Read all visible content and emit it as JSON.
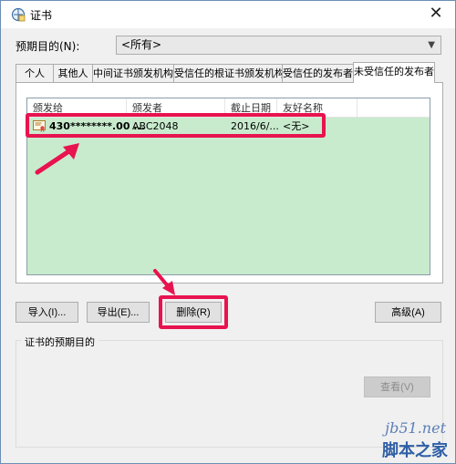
{
  "window": {
    "title": "证书",
    "close_glyph": "✕"
  },
  "purpose": {
    "label": "预期目的(N):",
    "selected": "<所有>"
  },
  "tabs": [
    {
      "label": "个人",
      "active": false
    },
    {
      "label": "其他人",
      "active": false
    },
    {
      "label": "中间证书颁发机构",
      "active": false
    },
    {
      "label": "受信任的根证书颁发机构",
      "active": false
    },
    {
      "label": "受信任的发布者",
      "active": false
    },
    {
      "label": "未受信任的发布者",
      "active": true
    }
  ],
  "list": {
    "columns": [
      "颁发给",
      "颁发者",
      "截止日期",
      "友好名称"
    ],
    "rows": [
      {
        "issued_to": "430********.00 ...",
        "issuer": "ABC2048",
        "expiry": "2016/6/...",
        "friendly": "<无>"
      }
    ],
    "background": "#c8ebcd"
  },
  "buttons": {
    "import": "导入(I)...",
    "export": "导出(E)...",
    "remove": "删除(R)",
    "advanced": "高级(A)",
    "view": "查看(V)"
  },
  "purposes_group": {
    "label": "证书的预期目的"
  },
  "annotation_color": "#e8134f",
  "watermark": {
    "url": "jb51.net",
    "text": "脚本之家"
  },
  "icons": [
    "certificate-manager-icon",
    "close-icon",
    "chevron-down-icon",
    "certificate-icon"
  ]
}
